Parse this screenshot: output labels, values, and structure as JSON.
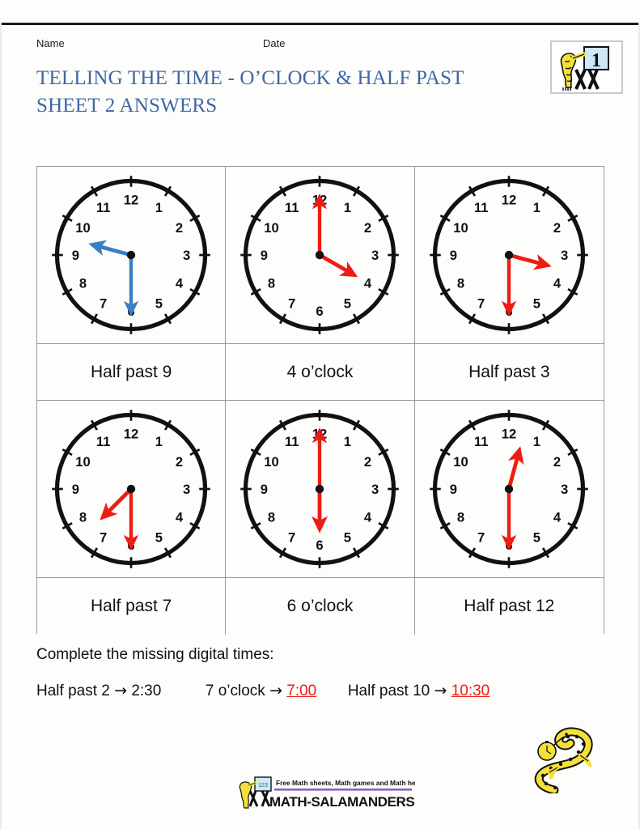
{
  "header": {
    "name_label": "Name",
    "date_label": "Date",
    "title_line1": "TELLING THE TIME - O’CLOCK & HALF PAST",
    "title_line2": "SHEET 2 ANSWERS",
    "title_color": "#3f66a5",
    "badge_number": "1",
    "badge_name": "math-salamanders-level-1-badge"
  },
  "clocks": [
    {
      "id": "clock-1",
      "hour_angle": 285,
      "minute_angle": 180,
      "hand_color": "#3c7ec4",
      "answer": "Half past 9"
    },
    {
      "id": "clock-2",
      "hour_angle": 120,
      "minute_angle": 0,
      "hand_color": "#ee1c12",
      "answer": "4 o’clock"
    },
    {
      "id": "clock-3",
      "hour_angle": 105,
      "minute_angle": 180,
      "hand_color": "#ee1c12",
      "answer": "Half past 3"
    },
    {
      "id": "clock-4",
      "hour_angle": 225,
      "minute_angle": 180,
      "hand_color": "#ee1c12",
      "answer": "Half past 7"
    },
    {
      "id": "clock-5",
      "hour_angle": 180,
      "minute_angle": 0,
      "hand_color": "#ee1c12",
      "answer": "6 o’clock"
    },
    {
      "id": "clock-6",
      "hour_angle": 15,
      "minute_angle": 180,
      "hand_color": "#ee1c12",
      "answer": "Half past 12"
    }
  ],
  "clock_numerals": [
    "12",
    "1",
    "2",
    "3",
    "4",
    "5",
    "6",
    "7",
    "8",
    "9",
    "10",
    "11"
  ],
  "answers": {
    "a1": "Half past 9",
    "a2": "4 o’clock",
    "a3": "Half past 3",
    "a4": "Half past 7",
    "a5": "6 o’clock",
    "a6": "Half past 12"
  },
  "exercise": {
    "prompt": "Complete the missing digital times:",
    "items": [
      {
        "label": "Half past 2",
        "arrow": "→",
        "value": "2:30",
        "is_answer": false
      },
      {
        "label": "7 o’clock",
        "arrow": "→",
        "value": "7:00",
        "is_answer": true
      },
      {
        "label": "Half past 10",
        "arrow": "→",
        "value": "10:30",
        "is_answer": true
      }
    ],
    "answer_color": "#ee1c12"
  },
  "footer": {
    "tagline": "Free Math sheets, Math games and Math help",
    "site": "MATH-SALAMANDERS.COM",
    "rule_color": "#8b5fbf",
    "mascot_name": "salamander-with-pocket-watch"
  }
}
